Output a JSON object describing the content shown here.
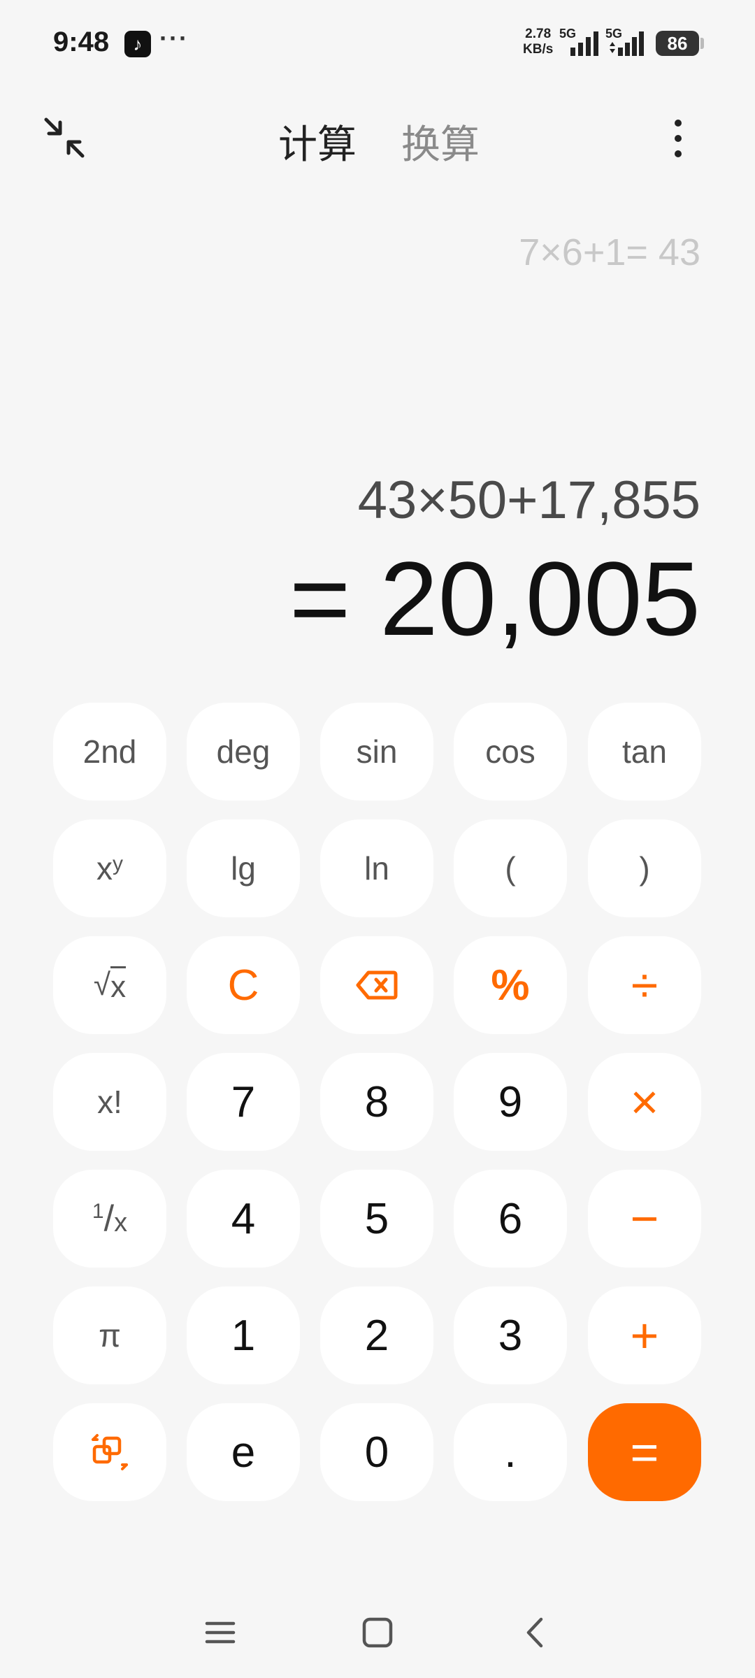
{
  "status_bar": {
    "time": "9:48",
    "app_icon": "tiktok-icon",
    "more": "···",
    "speed_value": "2.78",
    "speed_unit": "KB/s",
    "net1": "5G",
    "net2": "5G",
    "battery": "86"
  },
  "header": {
    "tab_calculate": "计算",
    "tab_convert": "换算",
    "collapse_icon": "collapse-icon",
    "more_icon": "more-vertical-icon"
  },
  "display": {
    "history": "7×6+1= 43",
    "expression": "43×50+17,855",
    "result": "= 20,005"
  },
  "keypad": {
    "k_2nd": "2nd",
    "k_deg": "deg",
    "k_sin": "sin",
    "k_cos": "cos",
    "k_tan": "tan",
    "k_xy_base": "x",
    "k_xy_exp": "y",
    "k_lg": "lg",
    "k_ln": "ln",
    "k_lparen": "(",
    "k_rparen": ")",
    "k_sqrt_radical": "√",
    "k_sqrt_x": "x",
    "k_clear": "C",
    "k_percent": "%",
    "k_divide": "÷",
    "k_fact": "x!",
    "k_7": "7",
    "k_8": "8",
    "k_9": "9",
    "k_multiply": "×",
    "k_recip_num": "1",
    "k_recip_slash": "/",
    "k_recip_x": "x",
    "k_4": "4",
    "k_5": "5",
    "k_6": "6",
    "k_minus": "−",
    "k_pi": "π",
    "k_1": "1",
    "k_2": "2",
    "k_3": "3",
    "k_plus": "+",
    "k_e": "e",
    "k_0": "0",
    "k_dot": ".",
    "k_equals": "=",
    "backspace_icon": "backspace-icon",
    "switch_icon": "switch-layout-icon"
  },
  "colors": {
    "accent": "#ff6a00",
    "background": "#f6f6f6",
    "key": "#ffffff"
  },
  "nav": {
    "menu_icon": "menu-icon",
    "home_icon": "home-icon",
    "back_icon": "back-icon"
  }
}
